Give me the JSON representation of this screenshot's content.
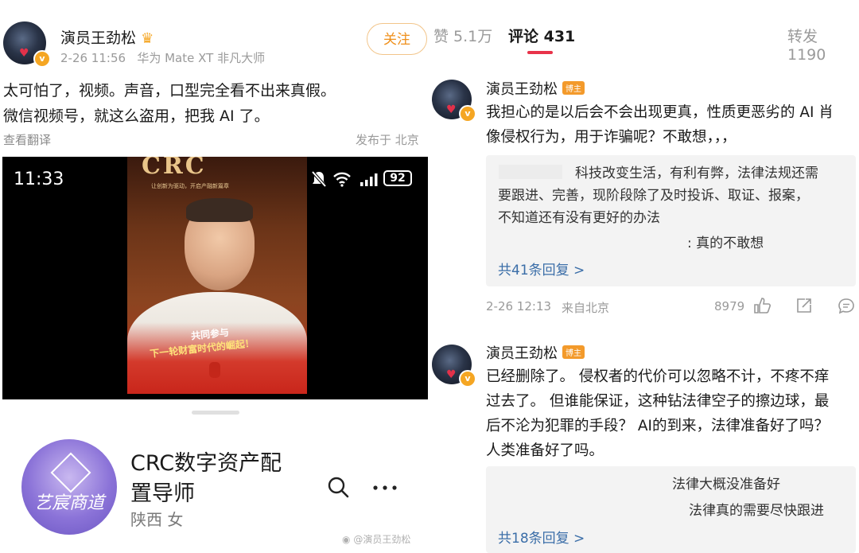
{
  "post": {
    "author": "演员王劲松",
    "meta": "2-26 11:56   华为 Mate XT 非凡大师",
    "follow_label": "关注",
    "text_line1": "太可怕了，视频。声音，口型完全看不出来真假。",
    "text_line2": "微信视频号，就这么盗用，把我 AI 了。",
    "translate": "查看翻译",
    "published_from": "发布于 北京"
  },
  "video": {
    "time": "11:33",
    "battery": "92",
    "banner_line1": "共同参与",
    "banner_line2": "下一轮财富时代的崛起！",
    "title_art": "CRC",
    "subtitle_art": "让创新为驱动，开启产融新篇章"
  },
  "profile": {
    "logo_text": "艺宸商道",
    "name_line1": "CRC数字资产配",
    "name_line2": "置导师",
    "sub": "陕西 女"
  },
  "watermark": "@演员王劲松",
  "tabs": {
    "likes": "赞 5.1万",
    "comments": "评论 431",
    "reposts": "转发 1190"
  },
  "comments": [
    {
      "author": "演员王劲松",
      "badge": "博主",
      "line1": "我担心的是以后会不会出现更真，性质更恶劣的 AI 肖",
      "line2": "像侵权行为，用于诈骗呢？不敢想，，，",
      "replies": [
        {
          "line1": "科技改变生活，有利有弊，法律法规还需",
          "line2": "要跟进、完善，现阶段除了及时投诉、取证、报案，",
          "line3": "不知道还有没有更好的办法"
        },
        {
          "line1": ": 真的不敢想"
        }
      ],
      "more": "共41条回复 >",
      "time": "2-26 12:13",
      "location": "来自北京",
      "likes": "8979"
    },
    {
      "author": "演员王劲松",
      "badge": "博主",
      "line1": "已经删除了。 侵权者的代价可以忽略不计，不疼不痒",
      "line2": "过去了。 但谁能保证，这种钻法律空子的擦边球，最",
      "line3": "后不沦为犯罪的手段？ AI的到来，法律准备好了吗？",
      "line4": "人类准备好了吗。",
      "replies": [
        {
          "line1": "法律大概没准备好"
        },
        {
          "line1": "法律真的需要尽快跟进"
        }
      ],
      "more": "共18条回复 >"
    }
  ],
  "colors": {
    "accent_orange": "#ef8f1a",
    "link_blue": "#3b6ea8",
    "tab_underline": "#e8334a",
    "badge_orange": "#f39a2b"
  },
  "icons": [
    "crown-icon",
    "verified-icon",
    "mute-icon",
    "wifi-icon",
    "signal-icon",
    "battery-icon",
    "search-icon",
    "more-icon",
    "like-icon",
    "share-icon",
    "comment-icon",
    "weibo-icon"
  ]
}
